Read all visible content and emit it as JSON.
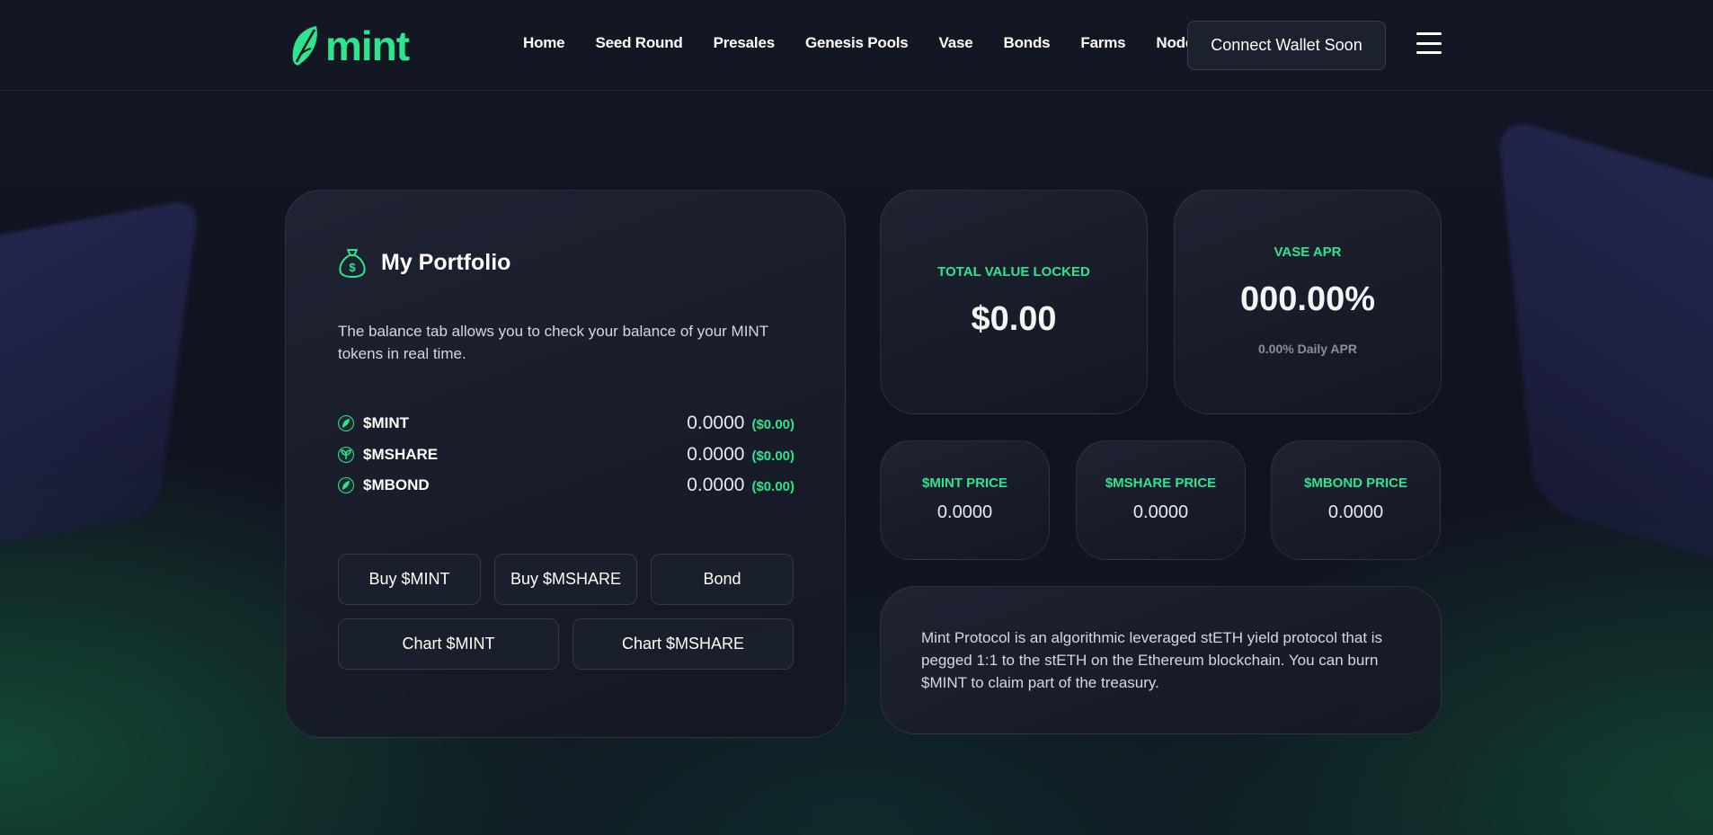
{
  "brand": {
    "name": "mint",
    "accent": "#2ee58f"
  },
  "nav": {
    "items": [
      "Home",
      "Seed Round",
      "Presales",
      "Genesis Pools",
      "Vase",
      "Bonds",
      "Farms",
      "Nodes"
    ],
    "connect_label": "Connect Wallet Soon",
    "menu_icon": "hamburger-icon"
  },
  "portfolio": {
    "title": "My Portfolio",
    "icon": "money-bag-icon",
    "description": "The balance tab allows you to check your balance of your MINT tokens in real time.",
    "tokens": [
      {
        "name": "$MINT",
        "amount": "0.0000",
        "usd": "($0.00)",
        "icon": "leaf-icon"
      },
      {
        "name": "$MSHARE",
        "amount": "0.0000",
        "usd": "($0.00)",
        "icon": "share-icon"
      },
      {
        "name": "$MBOND",
        "amount": "0.0000",
        "usd": "($0.00)",
        "icon": "leaf-icon"
      }
    ],
    "buttons": {
      "buy_mint": "Buy $MINT",
      "buy_mshare": "Buy $MSHARE",
      "bond": "Bond",
      "chart_mint": "Chart $MINT",
      "chart_mshare": "Chart $MSHARE"
    }
  },
  "tvl": {
    "label": "TOTAL VALUE LOCKED",
    "value": "$0.00"
  },
  "vase_apr": {
    "label": "VASE APR",
    "value": "000.00%",
    "daily": "0.00% Daily APR"
  },
  "prices": [
    {
      "label": "$MINT PRICE",
      "value": "0.0000"
    },
    {
      "label": "$MSHARE PRICE",
      "value": "0.0000"
    },
    {
      "label": "$MBOND PRICE",
      "value": "0.0000"
    }
  ],
  "about": {
    "text": "Mint Protocol is an algorithmic leveraged stETH yield protocol that is pegged 1:1 to the stETH on the Ethereum blockchain. You can burn $MINT to claim part of the treasury."
  }
}
